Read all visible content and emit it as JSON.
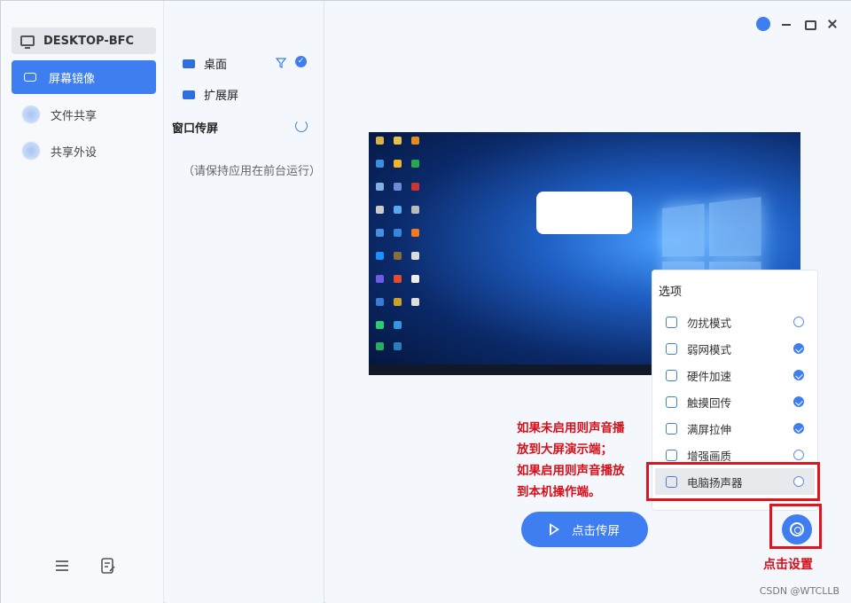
{
  "device": {
    "name": "DESKTOP-BFC"
  },
  "sidebar": {
    "items": [
      {
        "label": "屏幕镜像",
        "active": true
      },
      {
        "label": "文件共享",
        "active": false
      },
      {
        "label": "共享外设",
        "active": false
      }
    ]
  },
  "sources": {
    "desktop_label": "桌面",
    "extend_label": "扩展屏",
    "window_section": "窗口传屏",
    "hint": "（请保持应用在前台运行）"
  },
  "options": {
    "title": "选项",
    "items": [
      {
        "label": "勿扰模式",
        "checked": false
      },
      {
        "label": "弱网模式",
        "checked": true
      },
      {
        "label": "硬件加速",
        "checked": true
      },
      {
        "label": "触摸回传",
        "checked": true
      },
      {
        "label": "满屏拉伸",
        "checked": true
      },
      {
        "label": "增强画质",
        "checked": false
      },
      {
        "label": "电脑扬声器",
        "checked": false
      }
    ]
  },
  "annotations": {
    "speaker_note_lines": [
      "如果未启用则声音播",
      "放到大屏演示端；",
      "如果启用则声音播放",
      "到本机操作端。"
    ],
    "settings_note": "点击设置"
  },
  "actions": {
    "cast_label": "点击传屏"
  },
  "watermark": "CSDN @WTCLLB",
  "colors": {
    "accent": "#3f7ef0",
    "annotation": "#e0141c"
  }
}
